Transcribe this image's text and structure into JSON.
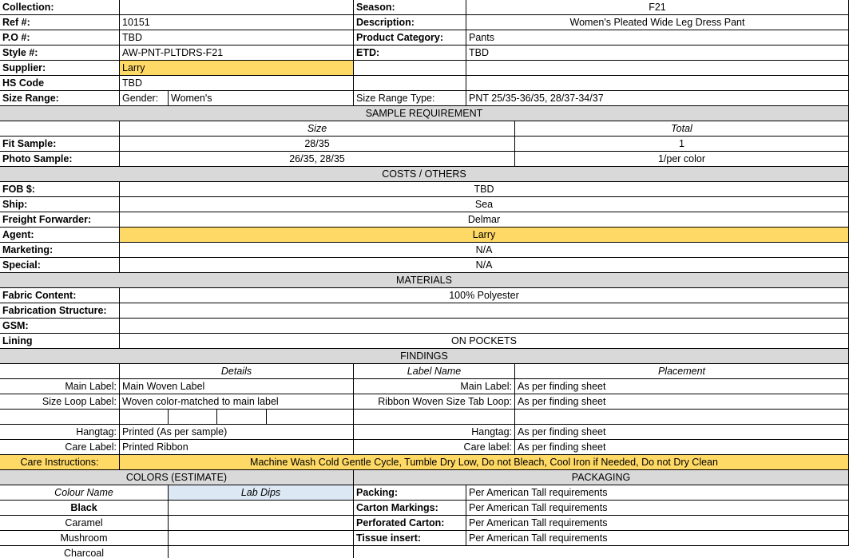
{
  "header": {
    "collection_label": "Collection:",
    "collection_value": "",
    "ref_label": "Ref #:",
    "ref_value": "10151",
    "po_label": "P.O #:",
    "po_value": "TBD",
    "style_label": "Style #:",
    "style_value": "AW-PNT-PLTDRS-F21",
    "supplier_label": "Supplier:",
    "supplier_value": "Larry",
    "hs_label": "HS Code",
    "hs_value": "TBD",
    "size_range_label": "Size Range:",
    "gender_label": "Gender:",
    "gender_value": "Women's",
    "season_label": "Season:",
    "season_value": "F21",
    "description_label": "Description:",
    "description_value": "Women's Pleated Wide Leg Dress Pant",
    "product_category_label": "Product Category:",
    "product_category_value": "Pants",
    "etd_label": "ETD:",
    "etd_value": "TBD",
    "size_range_type_label": "Size Range Type:",
    "size_range_type_value": "PNT 25/35-36/35, 28/37-34/37"
  },
  "sample": {
    "title": "SAMPLE REQUIREMENT",
    "size_header": "Size",
    "total_header": "Total",
    "rows": [
      {
        "label": "Fit Sample:",
        "size": "28/35",
        "total": "1"
      },
      {
        "label": "Photo Sample:",
        "size": "26/35, 28/35",
        "total": "1/per color"
      }
    ]
  },
  "costs": {
    "title": "COSTS / OTHERS",
    "rows": [
      {
        "label": "FOB $:",
        "value": "TBD"
      },
      {
        "label": "Ship:",
        "value": "Sea"
      },
      {
        "label": "Freight Forwarder:",
        "value": "Delmar"
      },
      {
        "label": "Agent:",
        "value": "Larry"
      },
      {
        "label": "Marketing:",
        "value": "N/A"
      },
      {
        "label": "Special:",
        "value": "N/A"
      }
    ]
  },
  "materials": {
    "title": "MATERIALS",
    "rows": [
      {
        "label": "Fabric Content:",
        "value": "100% Polyester"
      },
      {
        "label": "Fabrication Structure:",
        "value": ""
      },
      {
        "label": "GSM:",
        "value": ""
      },
      {
        "label": "Lining",
        "value": "ON POCKETS"
      }
    ]
  },
  "findings": {
    "title": "FINDINGS",
    "details_header": "Details",
    "label_name_header": "Label Name",
    "placement_header": "Placement",
    "main_label": {
      "label": "Main Label:",
      "detail": "Main Woven Label",
      "name": "Main Label:",
      "placement": "As per finding sheet"
    },
    "size_loop": {
      "label": "Size Loop Label:",
      "detail": "Woven color-matched to main label",
      "name": "Ribbon Woven Size Tab Loop:",
      "placement": "As per finding sheet"
    },
    "hangtag": {
      "label": "Hangtag:",
      "detail": "Printed (As per sample)",
      "name": "Hangtag:",
      "placement": "As per finding sheet"
    },
    "care_label": {
      "label": "Care Label:",
      "detail": "Printed Ribbon",
      "name": "Care label:",
      "placement": "As per finding sheet"
    },
    "care_instructions_label": "Care Instructions:",
    "care_instructions_value": "Machine Wash Cold Gentle Cycle, Tumble Dry Low, Do not Bleach, Cool Iron if Needed, Do not Dry Clean"
  },
  "colors": {
    "title": "COLORS (ESTIMATE)",
    "colour_name_header": "Colour Name",
    "lab_dips_header": "Lab Dips",
    "items": [
      "Black",
      "Caramel",
      "Mushroom",
      "Charcoal"
    ]
  },
  "packaging": {
    "title": "PACKAGING",
    "rows": [
      {
        "label": "Packing:",
        "value": "Per American Tall requirements"
      },
      {
        "label": "Carton Markings:",
        "value": "Per American Tall requirements"
      },
      {
        "label": "Perforated Carton:",
        "value": "Per American Tall requirements"
      },
      {
        "label": "Tissue insert:",
        "value": "Per American Tall requirements"
      }
    ]
  },
  "colors_palette": {
    "grey_band": "#d9d9d9",
    "yellow_highlight": "#ffd966",
    "blue_highlight": "#dde8f5"
  }
}
